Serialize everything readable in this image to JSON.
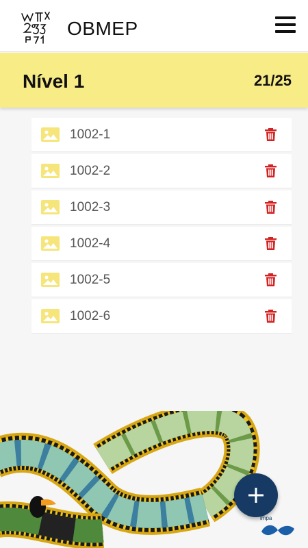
{
  "header": {
    "app_title": "OBMEP",
    "logo_icon": "obmep-logo-icon",
    "menu_icon": "hamburger-menu-icon"
  },
  "level": {
    "title": "Nível 1",
    "count": "21/25"
  },
  "items": [
    {
      "label": "1002-1"
    },
    {
      "label": "1002-2"
    },
    {
      "label": "1002-3"
    },
    {
      "label": "1002-4"
    },
    {
      "label": "1002-5"
    },
    {
      "label": "1002-6"
    }
  ],
  "fab": {
    "label": "+",
    "icon": "add-icon"
  },
  "footer": {
    "impa_text": "impa"
  },
  "colors": {
    "accent_yellow": "#f7ec86",
    "image_icon": "#f6e57a",
    "trash_red": "#d32222",
    "fab_blue": "#163a63"
  }
}
